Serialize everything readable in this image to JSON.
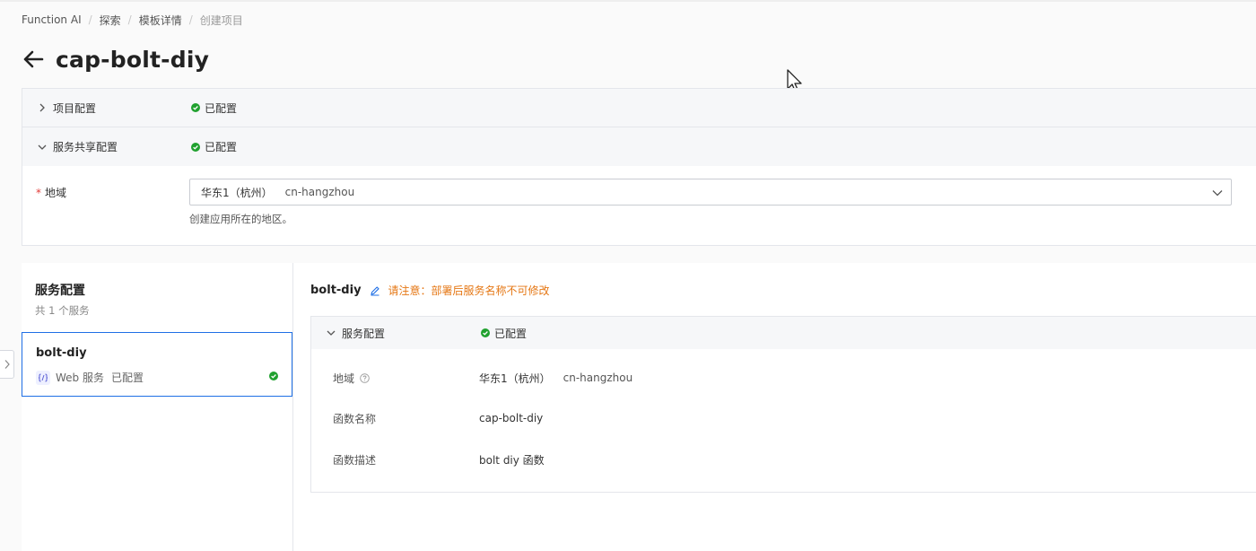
{
  "breadcrumb": [
    "Function AI",
    "探索",
    "模板详情",
    "创建项目"
  ],
  "page": {
    "title": "cap-bolt-diy"
  },
  "icons": {
    "back": "arrow-left-icon",
    "cursor": "mouse-pointer-icon",
    "ok": "check-circle-icon",
    "dropdown": "chevron-down-icon",
    "edit": "pencil-icon",
    "help": "question-circle-icon",
    "function": "function-code-icon"
  },
  "colors": {
    "primary": "#1f6fe5",
    "success": "#20a12f",
    "warning": "#e57714",
    "required": "#e23c39"
  },
  "project_config": {
    "label": "项目配置",
    "status": "已配置"
  },
  "shared_config": {
    "label": "服务共享配置",
    "status": "已配置",
    "region": {
      "label": "地域",
      "value_name": "华东1（杭州）",
      "value_code": "cn-hangzhou",
      "hint": "创建应用所在的地区。"
    }
  },
  "services": {
    "title": "服务配置",
    "count": "共 1 个服务",
    "items": [
      {
        "name": "bolt-diy",
        "type": "Web 服务",
        "status": "已配置"
      }
    ]
  },
  "detail": {
    "name": "bolt-diy",
    "warning": "请注意：部署后服务名称不可修改",
    "section": {
      "label": "服务配置",
      "status": "已配置",
      "fields": [
        {
          "key": "地域",
          "value": "华东1（杭州）",
          "code": "cn-hangzhou"
        },
        {
          "key": "函数名称",
          "value": "cap-bolt-diy"
        },
        {
          "key": "函数描述",
          "value": "bolt diy 函数"
        }
      ]
    }
  }
}
